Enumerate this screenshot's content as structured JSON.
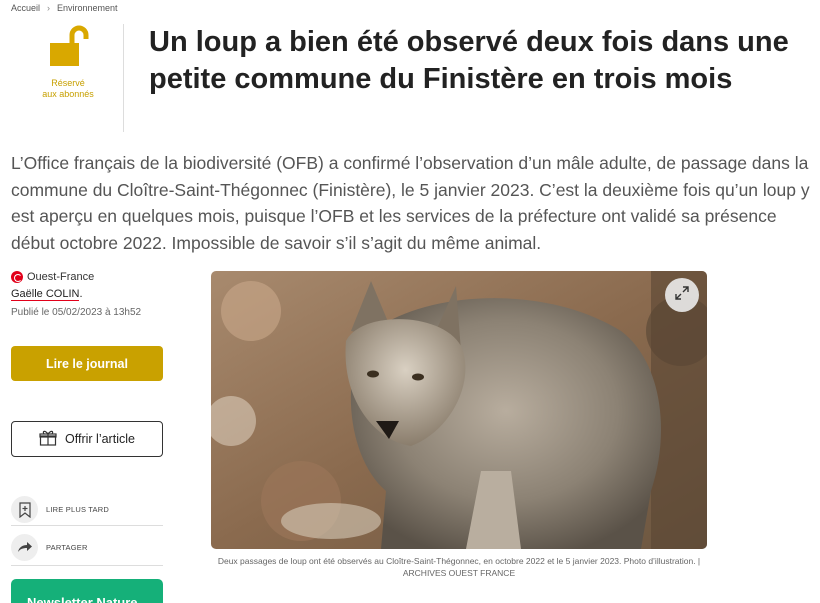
{
  "breadcrumb": {
    "home": "Accueil",
    "separator": "›",
    "section": "Environnement"
  },
  "premium": {
    "icon": "unlock-icon",
    "line1": "Réservé",
    "line2": "aux abonnés",
    "color": "#c7a000"
  },
  "article": {
    "title": "Un loup a bien été observé deux fois dans une petite commune du Finistère en trois mois",
    "chapo": "L’Office français de la biodiversité (OFB) a confirmé l’observation d’un mâle adulte, de passage dans la commune du Cloître-Saint-Thégonnec (Finistère), le 5 janvier 2023. C’est la deuxième fois qu’un loup y est aperçu en quelques mois, puisque l’OFB et les services de la préfecture ont validé sa présence début octobre 2022. Impossible de savoir s’il s’agit du même animal."
  },
  "meta": {
    "source": "Ouest-France",
    "author": "Gaëlle COLIN",
    "author_suffix": ".",
    "published": "Publié le 05/02/2023 à 13h52"
  },
  "buttons": {
    "journal": "Lire le journal",
    "offrir": "Offrir l’article",
    "read_later": "LIRE PLUS TARD",
    "share": "PARTAGER",
    "newsletter": "Newsletter Nature"
  },
  "photo": {
    "caption": "Deux passages de loup ont été observés au Cloître-Saint-Thégonnec, en octobre 2022 et le 5 janvier 2023. Photo d’illustration. | ARCHIVES OUEST FRANCE"
  },
  "colors": {
    "gold": "#c9a100",
    "brand_red": "#e2001a",
    "newsletter_green": "#15b079"
  }
}
